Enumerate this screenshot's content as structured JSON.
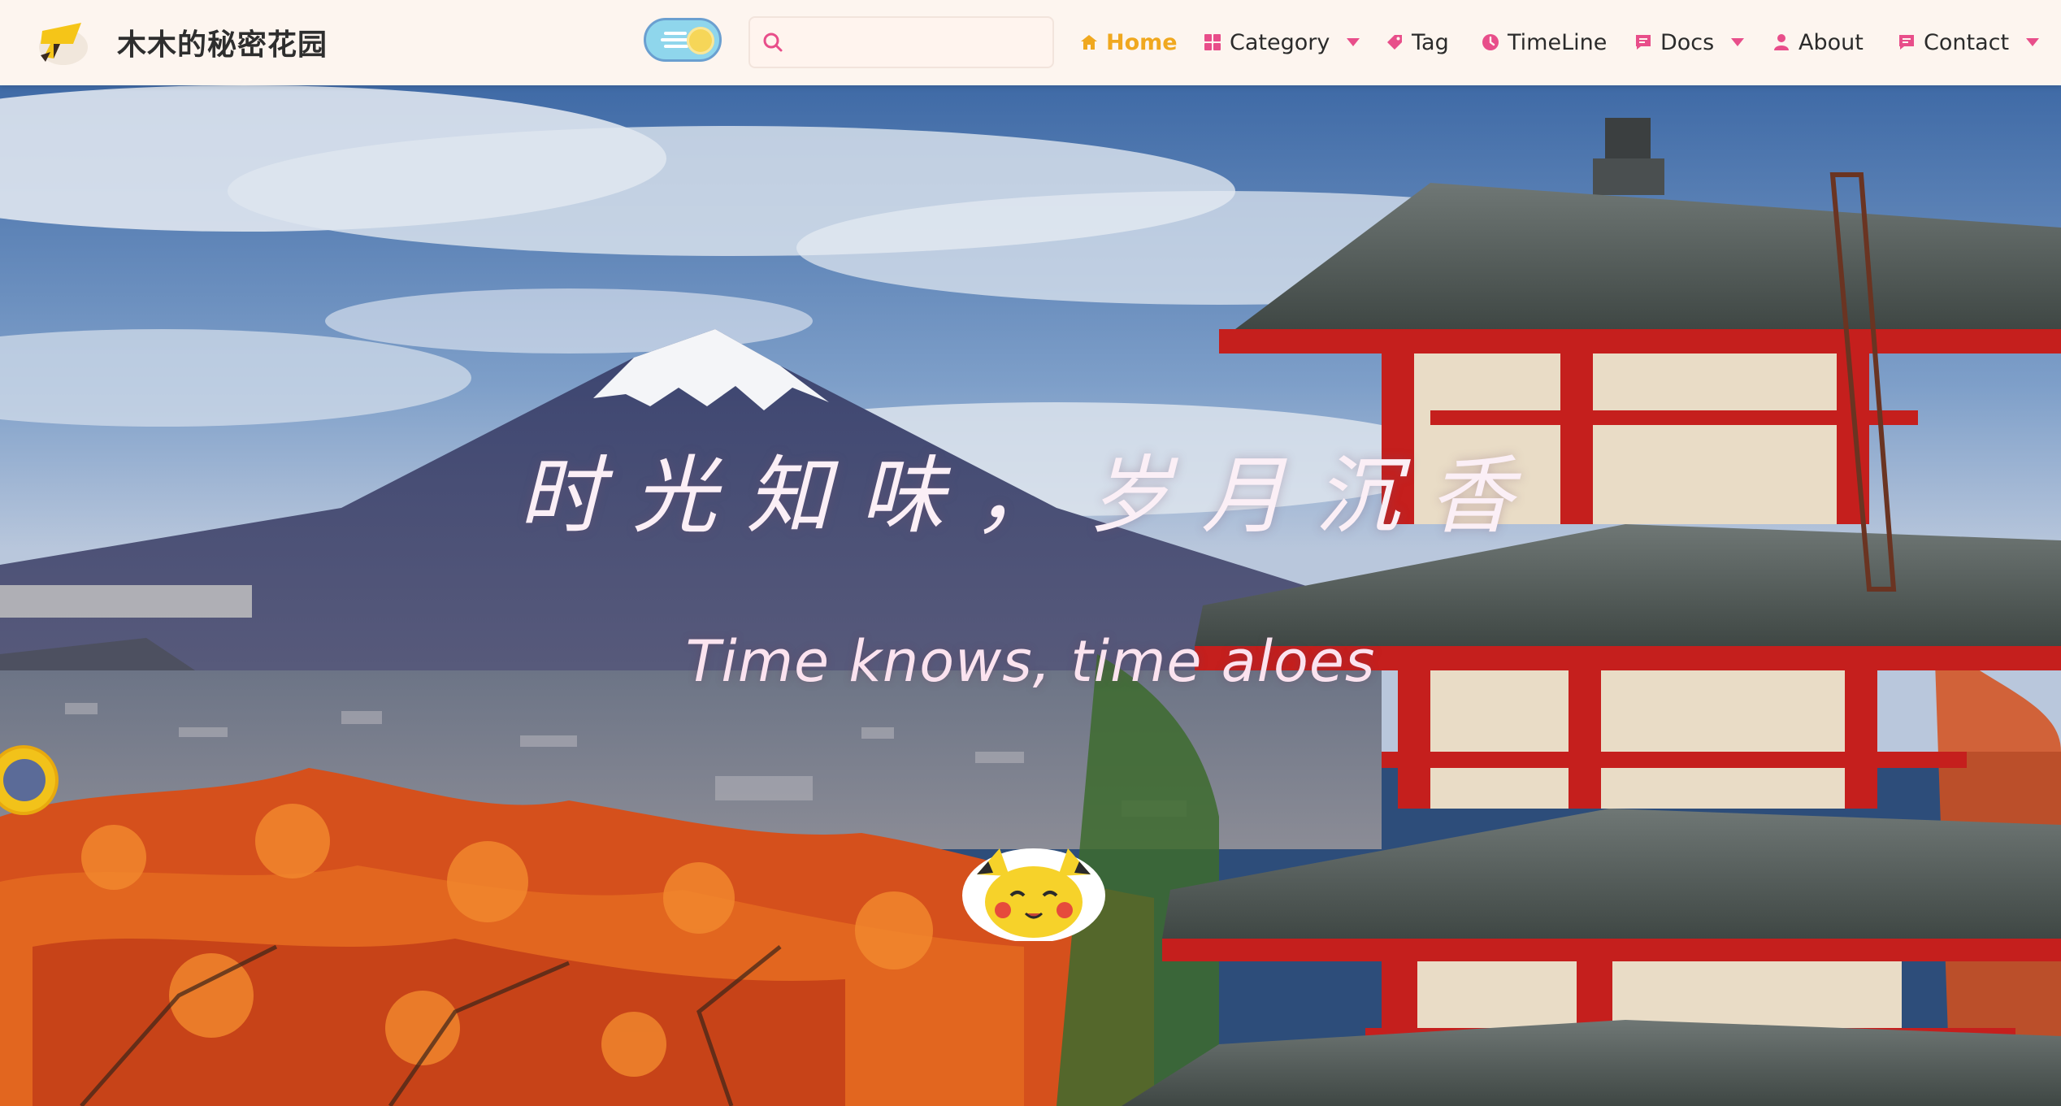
{
  "header": {
    "site_title": "木木的秘密花园",
    "search": {
      "placeholder": "",
      "value": ""
    },
    "theme_toggle_state": "light"
  },
  "nav": {
    "items": [
      {
        "label": "Home",
        "icon": "home-icon",
        "active": true
      },
      {
        "label": "Category",
        "icon": "category-icon",
        "dropdown": true
      },
      {
        "label": "Tag",
        "icon": "tag-icon"
      },
      {
        "label": "TimeLine",
        "icon": "clock-icon"
      },
      {
        "label": "Docs",
        "icon": "docs-icon",
        "dropdown": true
      },
      {
        "label": "About",
        "icon": "user-icon"
      },
      {
        "label": "Contact",
        "icon": "message-icon",
        "dropdown": true
      }
    ]
  },
  "hero": {
    "title": "时光知味，岁月沉香",
    "subtitle": "Time knows, time aloes",
    "background": "mount-fuji-pagoda-autumn-photo"
  },
  "colors": {
    "nav_bg": "#fdf5ef",
    "accent_active": "#f0a81f",
    "nav_icon_pink": "#e84e8a",
    "hero_text": "#fbeff6"
  }
}
